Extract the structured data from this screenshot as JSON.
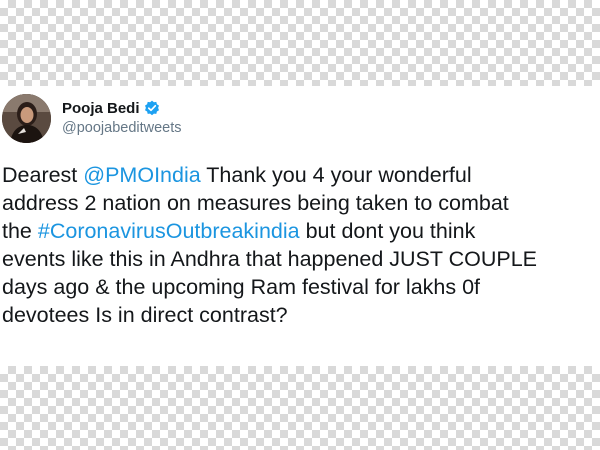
{
  "tweet": {
    "display_name": "Pooja Bedi",
    "handle": "@poojabeditweets",
    "verified": true,
    "avatar_icon": "profile-photo",
    "accent_color": "#1b95e0",
    "lines": [
      {
        "before": "Dearest ",
        "link": "@PMOIndia",
        "after": " Thank you 4 your wonderful"
      },
      {
        "before": "address 2 nation on measures being taken to combat",
        "link": "",
        "after": ""
      },
      {
        "before": "the ",
        "link": "#CoronavirusOutbreakindia",
        "after": " but dont you think"
      },
      {
        "before": "events like this in Andhra that happened JUST COUPLE",
        "link": "",
        "after": ""
      },
      {
        "before": "days ago & the upcoming Ram festival for lakhs 0f",
        "link": "",
        "after": ""
      },
      {
        "before": "devotees Is in direct contrast?",
        "link": "",
        "after": ""
      }
    ]
  }
}
